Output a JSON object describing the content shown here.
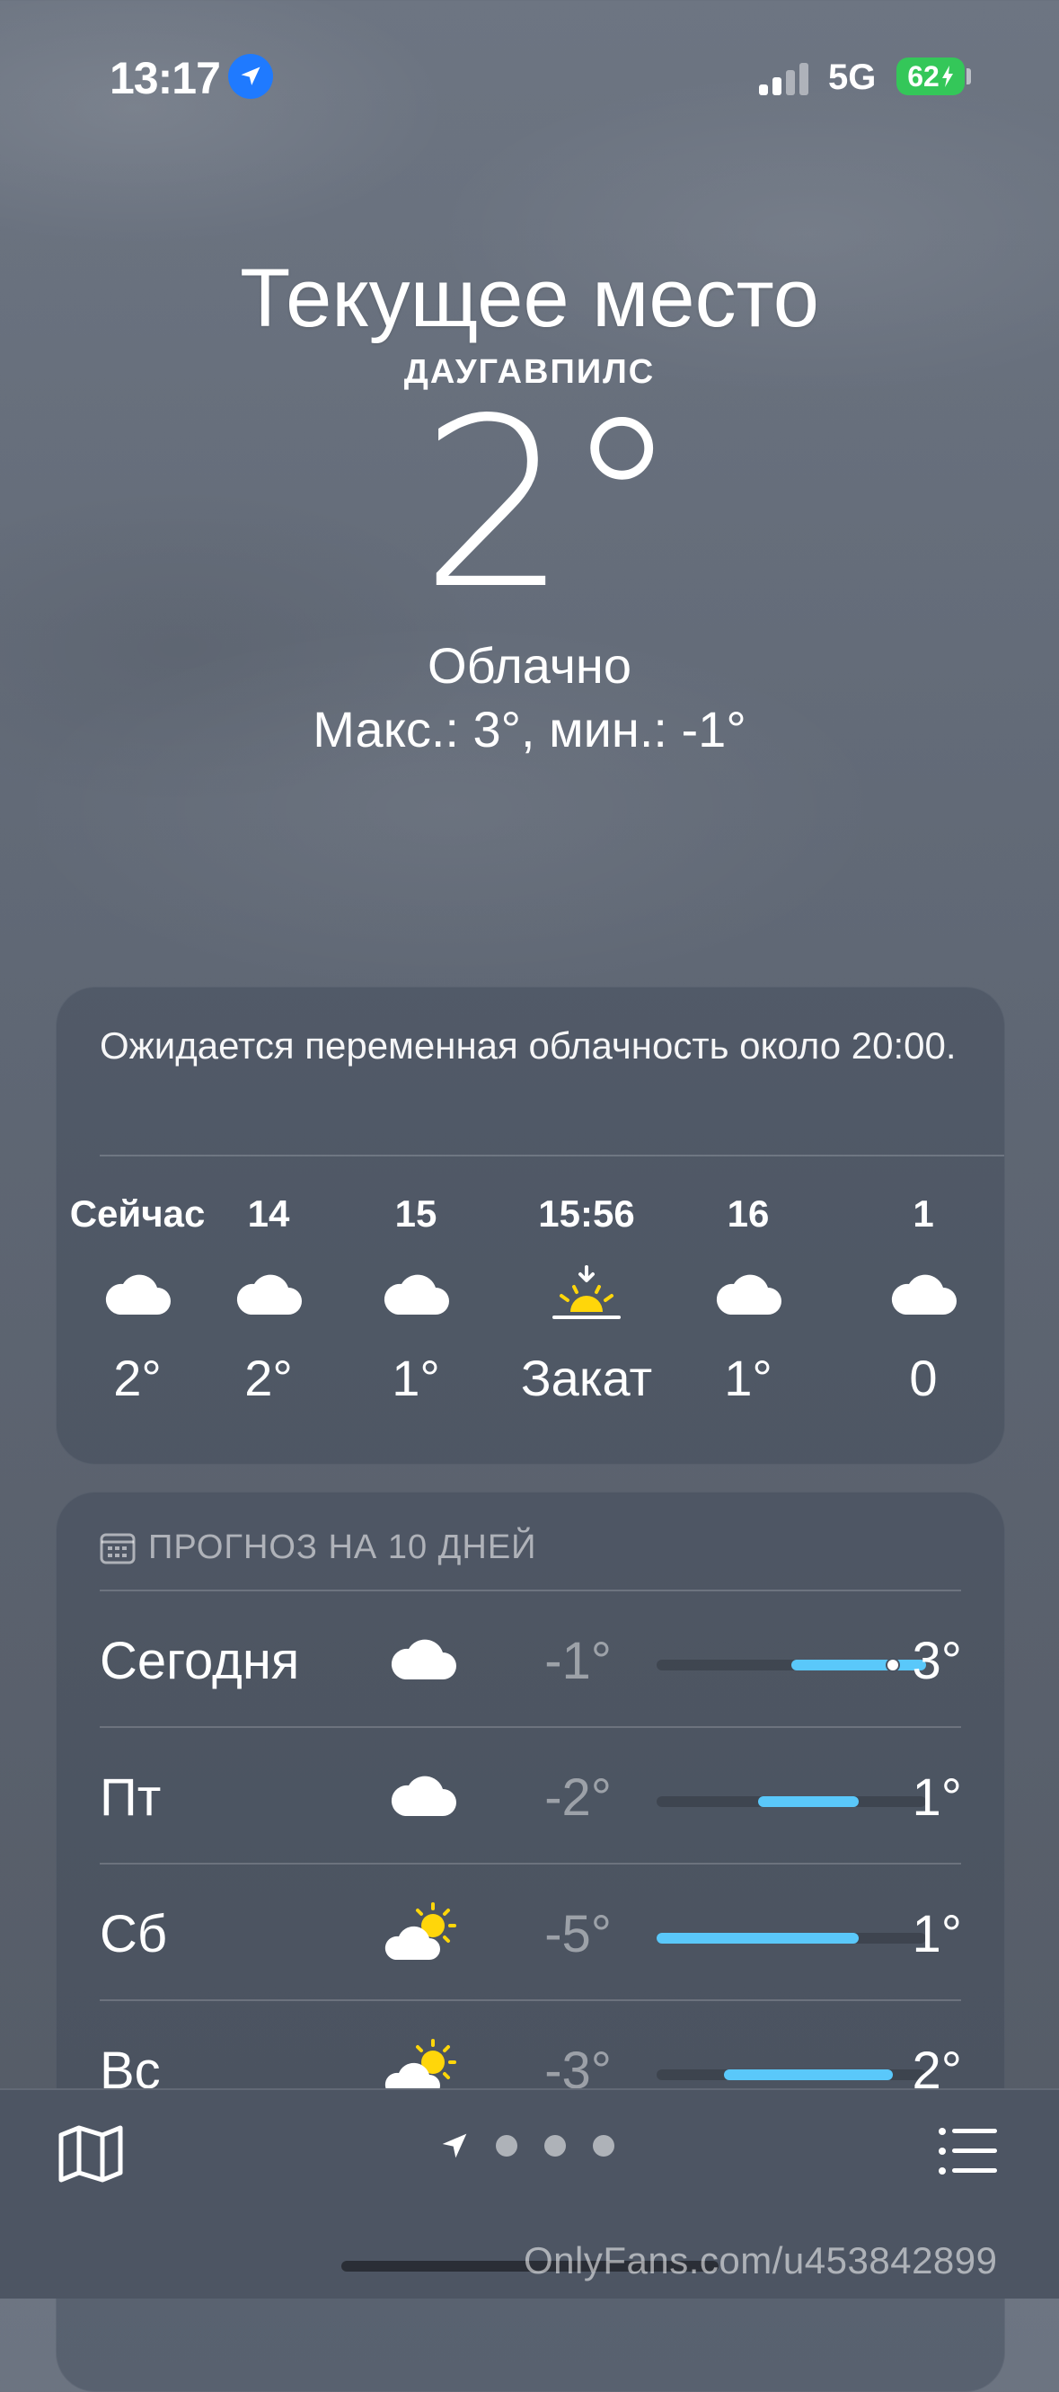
{
  "status_bar": {
    "time": "13:17",
    "network": "5G",
    "battery": "62"
  },
  "hero": {
    "title": "Текущее место",
    "subtitle": "ДАУГАВПИЛС",
    "temperature": "2°",
    "condition": "Облачно",
    "hi_lo": "Макс.: 3°, мин.: -1°"
  },
  "hourly": {
    "summary": "Ожидается переменная облачность около 20:00.",
    "items": [
      {
        "label": "Сейчас",
        "icon": "cloud-icon",
        "temp": "2°"
      },
      {
        "label": "14",
        "icon": "cloud-icon",
        "temp": "2°"
      },
      {
        "label": "15",
        "icon": "cloud-icon",
        "temp": "1°"
      },
      {
        "label": "15:56",
        "icon": "sunset-icon",
        "temp": "Закат"
      },
      {
        "label": "16",
        "icon": "cloud-icon",
        "temp": "1°"
      },
      {
        "label": "1",
        "icon": "cloud-icon",
        "temp": "0"
      }
    ]
  },
  "daily": {
    "header": "ПРОГНОЗ НА 10 ДНЕЙ",
    "range_scale": {
      "min": -5,
      "max": 3
    },
    "items": [
      {
        "day": "Сегодня",
        "icon": "cloud-icon",
        "low": "-1°",
        "high": "3°",
        "low_value": -1,
        "high_value": 3,
        "current_value": 2
      },
      {
        "day": "Пт",
        "icon": "cloud-icon",
        "low": "-2°",
        "high": "1°",
        "low_value": -2,
        "high_value": 1
      },
      {
        "day": "Сб",
        "icon": "partly-sunny-icon",
        "low": "-5°",
        "high": "1°",
        "low_value": -5,
        "high_value": 1
      },
      {
        "day": "Вс",
        "icon": "partly-sunny-icon",
        "low": "-3°",
        "high": "2°",
        "low_value": -3,
        "high_value": 2
      }
    ]
  },
  "colors": {
    "accent_blue": "#1f7aff",
    "battery_green": "#34c759",
    "range_blue": "#5ac8fa",
    "sun_yellow": "#ffd60a"
  },
  "watermark": "OnlyFans.com/u453842899"
}
